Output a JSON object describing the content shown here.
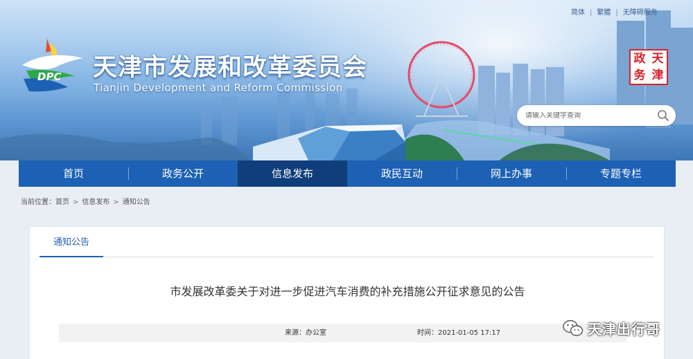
{
  "header": {
    "top_links": [
      "简体",
      "繁體",
      "无障碍服务"
    ],
    "site_title": "天津市发展和改革委员会",
    "site_subtitle": "Tianjin Development and Reform Commission",
    "logo_text": "DPC",
    "seal_chars": [
      "天",
      "津",
      "政",
      "务"
    ],
    "search": {
      "placeholder": "请输入关键字查询"
    }
  },
  "nav": {
    "items": [
      {
        "label": "首页"
      },
      {
        "label": "政务公开"
      },
      {
        "label": "信息发布",
        "active": true
      },
      {
        "label": "政民互动"
      },
      {
        "label": "网上办事"
      },
      {
        "label": "专题专栏"
      }
    ]
  },
  "breadcrumb": {
    "prefix": "当前位置：",
    "items": [
      "首页",
      "信息发布",
      "通知公告"
    ],
    "separator": ">"
  },
  "content": {
    "tab_label": "通知公告",
    "article_title": "市发展改革委关于对进一步促进汽车消费的补充措施公开征求意见的公告",
    "source": "来源：办公室",
    "time": "时间：2021-01-05 17:17"
  },
  "watermark": {
    "text": "天津出行哥",
    "icon": "wechat-icon"
  },
  "colors": {
    "nav_bg": "#1c61b3",
    "nav_active": "#0f3e7a",
    "seal_red": "#d6232a"
  }
}
